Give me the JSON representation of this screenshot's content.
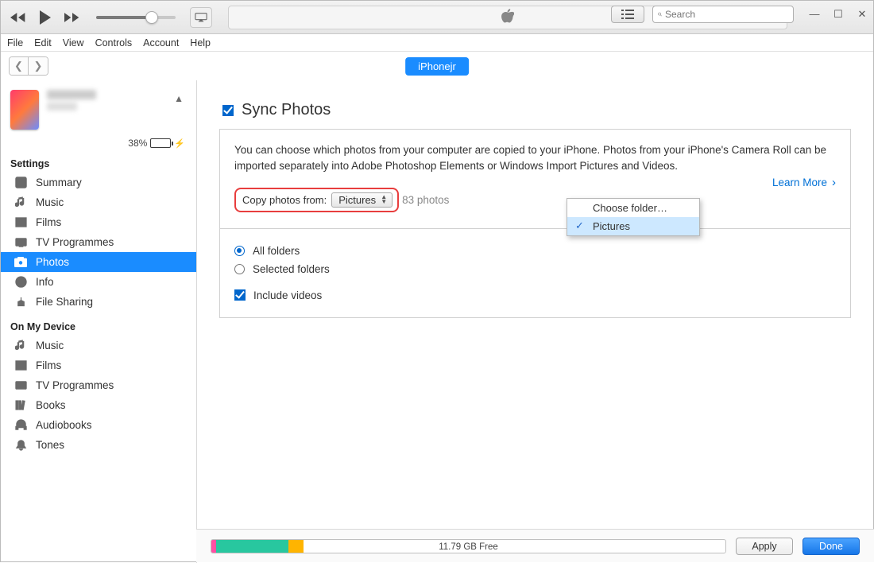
{
  "toolbar": {
    "search_placeholder": "Search"
  },
  "menubar": [
    "File",
    "Edit",
    "View",
    "Controls",
    "Account",
    "Help"
  ],
  "device_pill": "iPhonejr",
  "device": {
    "battery_pct": "38%"
  },
  "sidebar": {
    "settings_title": "Settings",
    "settings_items": [
      "Summary",
      "Music",
      "Films",
      "TV Programmes",
      "Photos",
      "Info",
      "File Sharing"
    ],
    "onmydevice_title": "On My Device",
    "onmydevice_items": [
      "Music",
      "Films",
      "TV Programmes",
      "Books",
      "Audiobooks",
      "Tones"
    ]
  },
  "main": {
    "title": "Sync Photos",
    "desc": "You can choose which photos from your computer are copied to your iPhone. Photos from your iPhone's Camera Roll can be imported separately into Adobe Photoshop Elements or Windows Import Pictures and Videos.",
    "copy_label": "Copy photos from:",
    "dropdown_value": "Pictures",
    "photo_count": "83 photos",
    "learn_more": "Learn More",
    "dd_options": [
      "Choose folder…",
      "Pictures"
    ],
    "opt_all": "All folders",
    "opt_selected": "Selected folders",
    "opt_include_videos": "Include videos"
  },
  "footer": {
    "storage_label": "11.79 GB Free",
    "segments": [
      {
        "color": "#ff4fa3",
        "w": "1%"
      },
      {
        "color": "#28c79f",
        "w": "14%"
      },
      {
        "color": "#ffb400",
        "w": "3%"
      }
    ],
    "apply": "Apply",
    "done": "Done"
  }
}
